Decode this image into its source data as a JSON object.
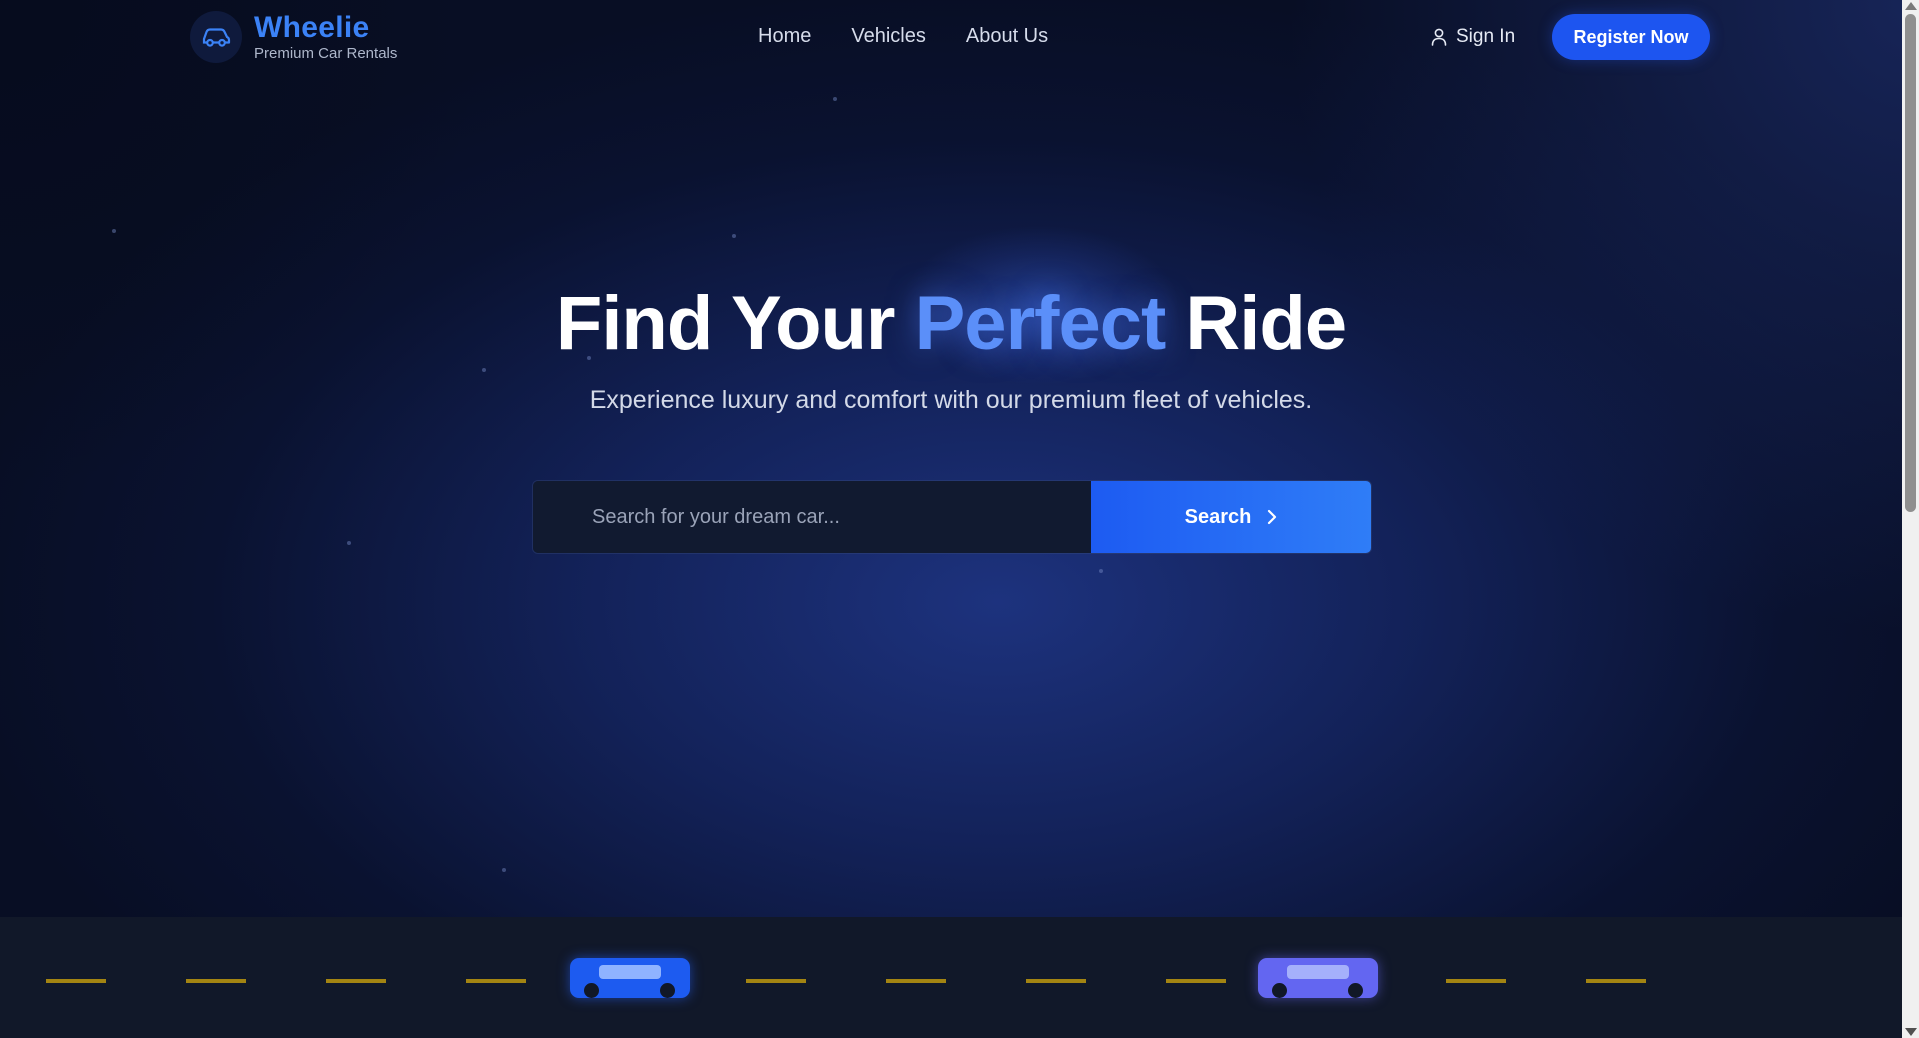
{
  "brand": {
    "name": "Wheelie",
    "tagline": "Premium Car Rentals",
    "icon": "car-icon",
    "color": "#3b82f6"
  },
  "nav": {
    "items": [
      {
        "label": "Home"
      },
      {
        "label": "Vehicles"
      },
      {
        "label": "About Us"
      }
    ]
  },
  "auth": {
    "sign_in_label": "Sign In",
    "sign_in_icon": "user-icon",
    "register_label": "Register Now"
  },
  "hero": {
    "title_part1": "Find Your ",
    "title_accent": "Perfect",
    "title_part2": " Ride",
    "subtitle": "Experience luxury and comfort with our premium fleet of vehicles.",
    "accent_color": "#5b8ff9"
  },
  "search": {
    "placeholder": "Search for your dream car...",
    "value": "",
    "button_label": "Search",
    "button_icon": "chevron-right-icon"
  },
  "road": {
    "dash_color": "#a38412",
    "cars": [
      {
        "name": "blue-car",
        "color": "#1d5bf0"
      },
      {
        "name": "purple-car",
        "color": "#6366f1"
      }
    ]
  },
  "colors": {
    "primary": "#1d55f0",
    "background": "#0a1126"
  }
}
